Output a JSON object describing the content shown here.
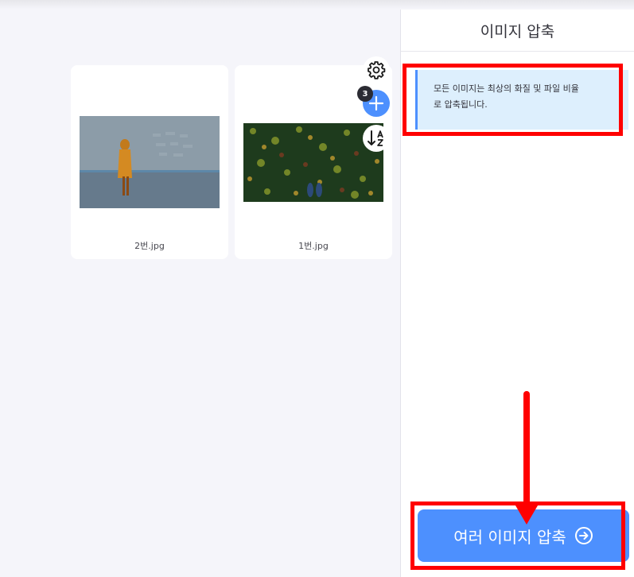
{
  "workspace": {
    "files": [
      {
        "name": "2번.jpg"
      },
      {
        "name": "1번.jpg"
      }
    ],
    "tools": {
      "settings_icon": "gear-icon",
      "add_icon": "plus-icon",
      "sort_icon": "sort-az-icon",
      "file_count": "3"
    }
  },
  "sidebar": {
    "title": "이미지 압축",
    "info_line1": "모든 이미지는 최상의 화질 및 파일 비율",
    "info_line2": "로 압축됩니다.",
    "submit_label": "여러 이미지 압축",
    "submit_icon": "arrow-right-circle-icon"
  },
  "colors": {
    "accent": "#4d90fe",
    "annotation": "#ff0000",
    "info_background": "#ddeffd"
  }
}
